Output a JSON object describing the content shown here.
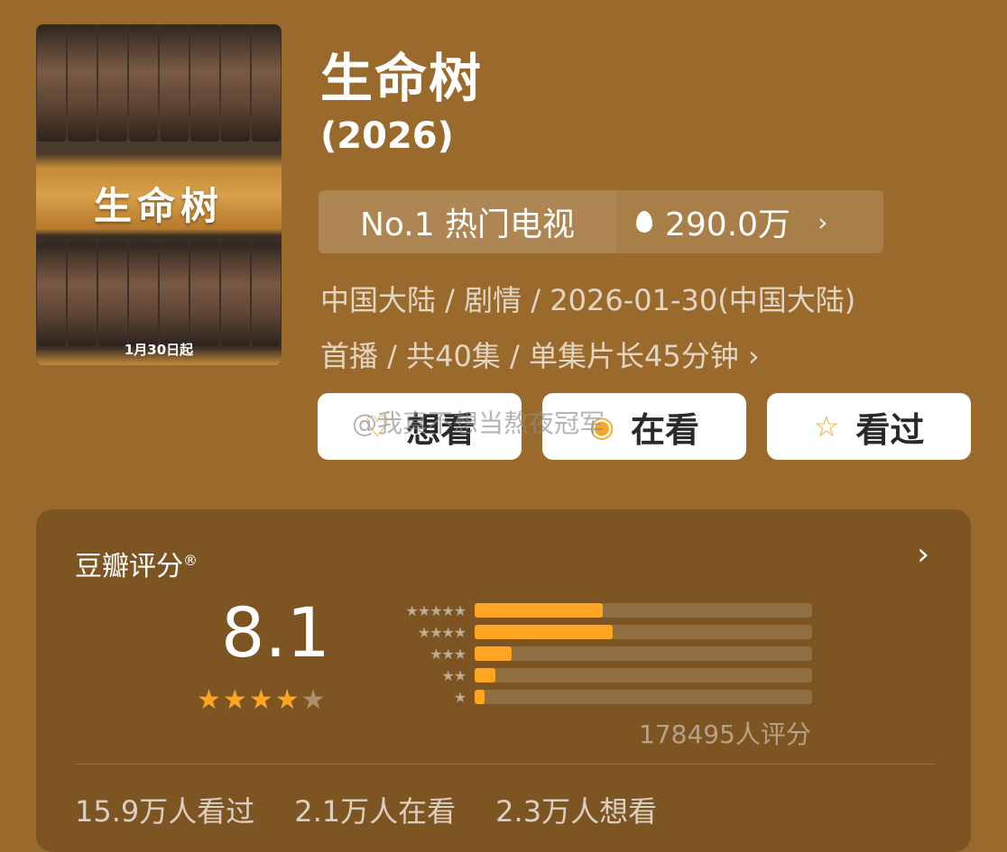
{
  "poster": {
    "title_art": "生命树",
    "date_text": "1月30日起"
  },
  "title": "生命树",
  "year": "(2026)",
  "ranking": {
    "label": "No.1 热门电视",
    "heat": "290.0万",
    "heat_icon": "fire-icon"
  },
  "meta": {
    "line1": "中国大陆 / 剧情 / 2026-01-30(中国大陆)",
    "line2": "首播 / 共40集 / 单集片长45分钟",
    "line2_chevron": "›"
  },
  "actions": [
    {
      "label": "想看",
      "icon": "add-heart-icon"
    },
    {
      "label": "在看",
      "icon": "watching-icon"
    },
    {
      "label": "看过",
      "icon": "star-outline-icon"
    }
  ],
  "watermark": "@我真不想当熬夜冠军",
  "rating": {
    "title": "豆瓣评分",
    "registered": "®",
    "score": "8.1",
    "stars_filled": 4,
    "stars_total": 5,
    "distribution": [
      {
        "stars": "★★★★★",
        "fraction": 0.38
      },
      {
        "stars": "★★★★",
        "fraction": 0.41
      },
      {
        "stars": "★★★",
        "fraction": 0.11
      },
      {
        "stars": "★★",
        "fraction": 0.06
      },
      {
        "stars": "★",
        "fraction": 0.03
      }
    ],
    "rater_count": "178495人评分",
    "chevron": "›"
  },
  "stats": {
    "watched": "15.9万人看过",
    "watching": "2.1万人在看",
    "want": "2.3万人想看"
  },
  "colors": {
    "background": "#9a6a2c",
    "accent": "#ffa51f"
  }
}
